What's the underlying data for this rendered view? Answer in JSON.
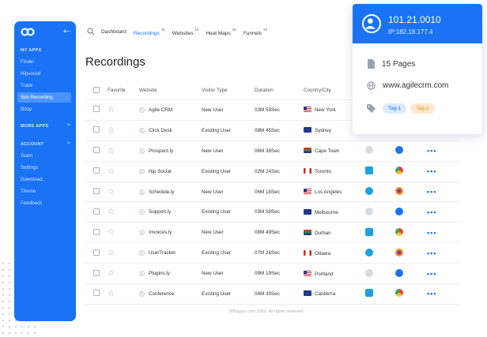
{
  "sidebar": {
    "sections": [
      {
        "label": "MY APPS",
        "items": [
          "Finder",
          "Hipsocial",
          "Track",
          "Site Recording",
          "Bitop"
        ]
      },
      {
        "label": "MORE APPS",
        "items": []
      },
      {
        "label": "ACCOUNT",
        "items": [
          "Team",
          "Settings",
          "Download",
          "Theme",
          "Feedback"
        ]
      }
    ],
    "active_item": "Site Recording"
  },
  "topbar": {
    "tabs": [
      {
        "label": "Dashboard",
        "count": ""
      },
      {
        "label": "Recordings",
        "count": "19"
      },
      {
        "label": "Websites",
        "count": "12"
      },
      {
        "label": "Heat Maps",
        "count": "26"
      },
      {
        "label": "Funnels",
        "count": "16"
      }
    ],
    "active_tab": "Recordings"
  },
  "page_title": "Recordings",
  "table": {
    "headers": [
      "Favorite",
      "Website",
      "Visitor Type",
      "Duration",
      "Country/City"
    ],
    "rows": [
      {
        "website": "Agile CRM",
        "visitor": "New User",
        "duration": "03M 59Sec",
        "flag": "us",
        "city": "New York",
        "os": "",
        "browser": "",
        "more": ""
      },
      {
        "website": "Click Desk",
        "visitor": "Existing User",
        "duration": "08M 45Sec",
        "flag": "au",
        "city": "Sydney",
        "os": "",
        "browser": "",
        "more": ""
      },
      {
        "website": "Prospect.ly",
        "visitor": "New User",
        "duration": "06M 38Sec",
        "flag": "za",
        "city": "Cape Town",
        "os": "apple",
        "browser": "ie",
        "more": "•••"
      },
      {
        "website": "Hip Social",
        "visitor": "Existing User",
        "duration": "02M 24Sec",
        "flag": "ca",
        "city": "Toronto",
        "os": "win",
        "browser": "chrome",
        "more": "•••"
      },
      {
        "website": "Schedule.ly",
        "visitor": "New User",
        "duration": "06M 18Sec",
        "flag": "us",
        "city": "Los Angeles",
        "os": "linux",
        "browser": "firefox",
        "more": "•••"
      },
      {
        "website": "Support.ly",
        "visitor": "Existing User",
        "duration": "03M 59Sec",
        "flag": "au",
        "city": "Melbourne",
        "os": "apple",
        "browser": "ie",
        "more": "•••"
      },
      {
        "website": "Invoices.ly",
        "visitor": "New User",
        "duration": "08M 49Sec",
        "flag": "za",
        "city": "Durban",
        "os": "win",
        "browser": "chrome",
        "more": "•••"
      },
      {
        "website": "UserTracker",
        "visitor": "Existing User",
        "duration": "07M 26Sec",
        "flag": "ca",
        "city": "Ottawa",
        "os": "linux",
        "browser": "firefox",
        "more": "•••"
      },
      {
        "website": "Plugins.ly",
        "visitor": "New User",
        "duration": "09M 19Sec",
        "flag": "us",
        "city": "Portland",
        "os": "apple",
        "browser": "ie",
        "more": "•••"
      },
      {
        "website": "Conference",
        "visitor": "Existing User",
        "duration": "04M 39Sec",
        "flag": "au",
        "city": "Canberra",
        "os": "win",
        "browser": "chrome",
        "more": "•••"
      }
    ]
  },
  "footer": "580apps.com 2020. All rights reserved",
  "visitor_card": {
    "ip": "101.21.0010",
    "ip_secondary": "IP:182.18.177.4",
    "pages": "15 Pages",
    "site": "www.agilecrm.com",
    "tags": [
      "Tag-1",
      "Tag-2"
    ]
  },
  "colors": {
    "accent": "#1a73f5",
    "tag1": "#dbeaff",
    "tag2": "#ffe9cf"
  }
}
